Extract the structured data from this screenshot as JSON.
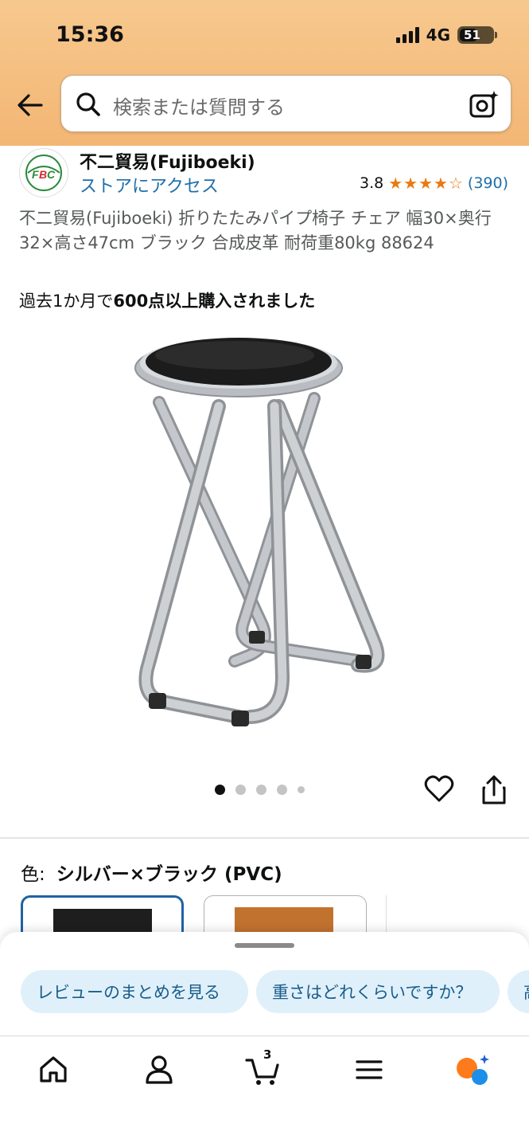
{
  "status_bar": {
    "time": "15:36",
    "network": "4G",
    "battery": "51"
  },
  "header": {
    "back_icon": "arrow-left-icon",
    "search_placeholder": "検索または質問する",
    "lens_icon": "camera-lens-icon"
  },
  "seller": {
    "logo_text": "FBC",
    "name": "不二貿易(Fujiboeki)",
    "store_link": "ストアにアクセス",
    "rating_value": "3.8",
    "rating_stars": 3.8,
    "rating_count": "(390)"
  },
  "product": {
    "title": "不二貿易(Fujiboeki) 折りたたみパイプ椅子 チェア 幅30×奥行32×高さ47cm ブラック 合成皮革 耐荷重80kg 88624",
    "bought_prefix": "過去1か月で",
    "bought_emphasis": "600点以上購入されました"
  },
  "image_carousel": {
    "dot_count": 5,
    "active_index": 0
  },
  "variant": {
    "label": "色:",
    "selected": "シルバー×ブラック (PVC)",
    "swatch_colors": [
      "#1e1e1e",
      "#c2722f"
    ]
  },
  "suggestions": {
    "chips": [
      "レビューのまとめを見る",
      "重さはどれくらいですか？",
      "高"
    ]
  },
  "bottom_nav": {
    "cart_count": "3",
    "items": [
      "home-icon",
      "user-icon",
      "cart-icon",
      "menu-icon",
      "rufus-assistant-icon"
    ]
  },
  "colors": {
    "header_bg": "#f5be80",
    "link": "#1f6fa8",
    "star": "#e97a12",
    "chip_bg": "#dff0fa",
    "selected_border": "#2162a1"
  }
}
